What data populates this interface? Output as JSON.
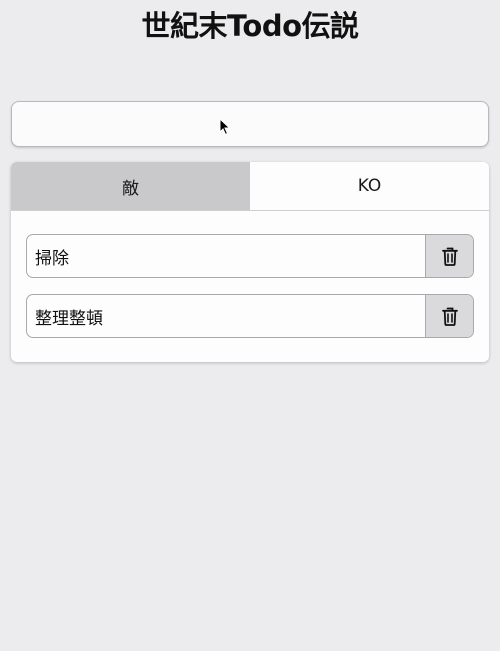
{
  "app": {
    "title": "世紀末Todo伝説"
  },
  "new_todo": {
    "value": "",
    "placeholder": ""
  },
  "tabs": [
    {
      "label": "敵",
      "active": true
    },
    {
      "label": "KO",
      "active": false
    }
  ],
  "todos": [
    {
      "text": "掃除",
      "delete_icon": "trash-icon"
    },
    {
      "text": "整理整頓",
      "delete_icon": "trash-icon"
    }
  ],
  "colors": {
    "background": "#ececee",
    "active_tab": "#c9c9cb",
    "delete_button": "#dadadc",
    "border": "#a9a9ad"
  }
}
